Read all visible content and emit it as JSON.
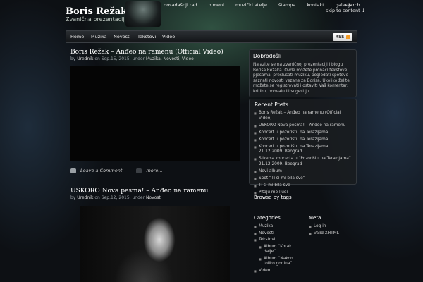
{
  "header": {
    "title": "Boris Režak",
    "description": "Zvanična prezentacija i blog",
    "top_nav": [
      "dosadašnji rad",
      "o meni",
      "muzički atelje",
      "štampa",
      "kontakt",
      "galerija"
    ],
    "search": "search",
    "skip": "skip to content ↓"
  },
  "navbar": {
    "items": [
      "Home",
      "Muzika",
      "Novosti",
      "Tekstovi",
      "Video"
    ],
    "rss": "RSS"
  },
  "posts": [
    {
      "title": "Boris Režak – Anđeo na ramenu (Official Video)",
      "meta_prefix": "by",
      "author": "Urednik",
      "date_text": "on Sep.15, 2015, under",
      "cats": [
        "Muzika",
        "Novosti",
        "Video"
      ],
      "comment": "Leave a Comment",
      "more": "more..."
    },
    {
      "title": "USKORO Nova pesma! – Anđeo na ramenu",
      "meta_prefix": "by",
      "author": "Urednik",
      "date_text": "on Sep.12, 2015, under",
      "cats": [
        "Novosti"
      ]
    }
  ],
  "sidebar": {
    "welcome_title": "Dobrodošli",
    "welcome_text": "Nalazite se na zvaničnoj prezentaciji i blogu Borisa Režaka. Ovde možete pronaći tekstove pjesama, preslušati muziku, pogledati spotove i saznati novosti vezane za Borisa. Ukoliko želite možete se registrovati i ostaviti Vaš komentar, kritiku, pohvalu ili sugestiju.",
    "recent_title": "Recent Posts",
    "recent": [
      "Boris Režak – Anđeo na ramenu (Official Video)",
      "USKORO Nova pesma! – Anđeo na ramenu",
      "Koncert u pozorištu na Terazijama",
      "Koncert u pozorištu na Terazijama",
      "Koncert u pozorištu na Terazijama 21.12.2009. Beograd",
      "Slike sa koncerta u “Pozorištu na Terazijama” 21.12.2009. Beograd",
      "Novi album",
      "Spot “Ti si mi bila sve”",
      "Ti si mi bila sve",
      "Pitaju me ljudi"
    ],
    "tags_title": "Browse by tags",
    "categories_title": "Categories",
    "categories": [
      "Muzika",
      "Novosti",
      "Tekstovi"
    ],
    "subcategories": [
      "Album “Korak dalje”",
      "Album “Nakon toliko godina”"
    ],
    "categories_after": [
      "Video"
    ],
    "meta_title": "Meta",
    "meta": [
      "Log in",
      "Valid XHTML"
    ]
  }
}
